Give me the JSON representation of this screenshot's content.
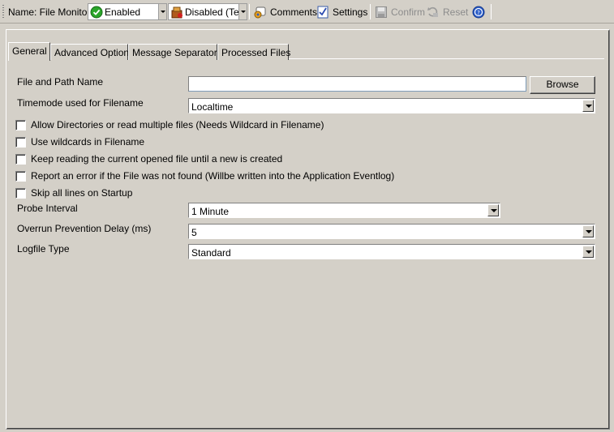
{
  "toolbar": {
    "name_label": "Name: File Monitor",
    "enabled_value": "Enabled",
    "disabled_value": "Disabled (Te",
    "comments_label": "Comments",
    "settings_label": "Settings",
    "confirm_label": "Confirm",
    "reset_label": "Reset",
    "icons": [
      "check-circle-icon",
      "disabled-icon",
      "comments-icon",
      "settings-icon",
      "save-icon",
      "reset-icon",
      "help-icon"
    ]
  },
  "tabs": [
    {
      "label": "General",
      "active": true
    },
    {
      "label": "Advanced Options"
    },
    {
      "label": "Message Separators"
    },
    {
      "label": "Processed Files"
    }
  ],
  "form": {
    "file_path_label": "File and Path Name",
    "file_path_value": "",
    "browse_label": "Browse",
    "timemode_label": "Timemode used for Filename",
    "timemode_value": "Localtime",
    "checkboxes": [
      {
        "label": "Allow Directories or read multiple files (Needs Wildcard in Filename)",
        "checked": false
      },
      {
        "label": "Use wildcards in Filename",
        "checked": false
      },
      {
        "label": "Keep reading the current opened file until a new is created",
        "checked": false
      },
      {
        "label": "Report an error if the File was not found (Willbe written into the Application Eventlog)",
        "checked": false
      },
      {
        "label": "Skip all lines on Startup",
        "checked": false
      }
    ],
    "probe_label": "Probe Interval",
    "probe_value": "1 Minute",
    "overrun_label": "Overrun Prevention Delay (ms)",
    "overrun_value": "5",
    "logfile_label": "Logfile Type",
    "logfile_value": "Standard"
  },
  "colors": {
    "background": "#d4d0c8",
    "enabled_green": "#2aa52a",
    "help_blue": "#2a5cc8"
  }
}
